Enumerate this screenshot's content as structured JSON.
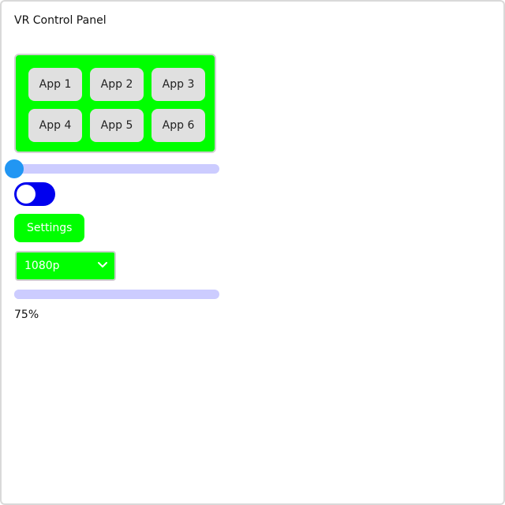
{
  "window": {
    "title": "VR Control Panel"
  },
  "apps": [
    {
      "label": "App 1"
    },
    {
      "label": "App 2"
    },
    {
      "label": "App 3"
    },
    {
      "label": "App 4"
    },
    {
      "label": "App 5"
    },
    {
      "label": "App 6"
    }
  ],
  "slider": {
    "value": 0
  },
  "toggle": {
    "on": false
  },
  "settings": {
    "label": "Settings"
  },
  "resolution": {
    "selected": "1080p"
  },
  "progress": {
    "value": 0.75,
    "label": "75%"
  },
  "colors": {
    "panel_green": "#00ff00",
    "toggle_blue": "#0000ee",
    "slider_thumb": "#2196f3",
    "track": "#ccccff"
  }
}
